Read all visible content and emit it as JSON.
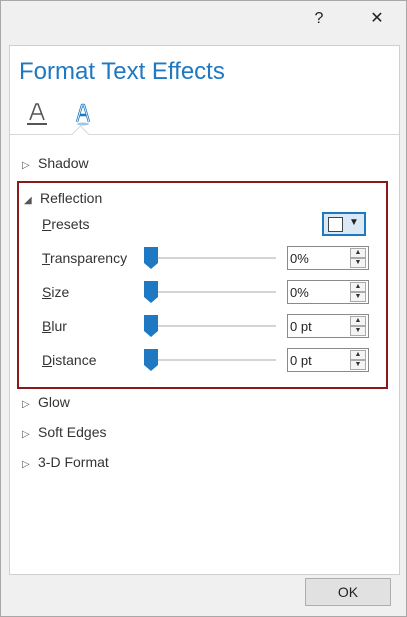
{
  "titlebar": {
    "help_label": "?",
    "close_label": "✕"
  },
  "pane": {
    "title": "Format Text Effects",
    "tabs": [
      {
        "icon": "text-fill-outline-icon"
      },
      {
        "icon": "text-effects-icon",
        "selected": true
      }
    ]
  },
  "sections": {
    "shadow": {
      "label": "Shadow",
      "expanded": false
    },
    "reflection": {
      "label": "Reflection",
      "expanded": true,
      "presets": {
        "label_ul": "P",
        "label_rest": "resets"
      },
      "transparency": {
        "label_ul": "T",
        "label_rest": "ransparency",
        "value": "0%",
        "level": 0
      },
      "size": {
        "label_ul": "S",
        "label_rest": "ize",
        "value": "0%",
        "level": 0
      },
      "blur": {
        "label_ul": "B",
        "label_rest": "lur",
        "value": "0 pt",
        "level": 0
      },
      "distance": {
        "label_ul": "D",
        "label_rest": "istance",
        "value": "0 pt",
        "level": 0
      }
    },
    "glow": {
      "label": "Glow",
      "expanded": false
    },
    "soft_edges": {
      "label": "Soft Edges",
      "expanded": false
    },
    "three_d_format": {
      "label": "3-D Format",
      "expanded": false
    }
  },
  "icons": {
    "collapsed": "▷",
    "expanded": "◢"
  },
  "footer": {
    "ok_label": "OK"
  },
  "colors": {
    "accent": "#1e78c2",
    "highlight_border": "#8b1a1a"
  }
}
